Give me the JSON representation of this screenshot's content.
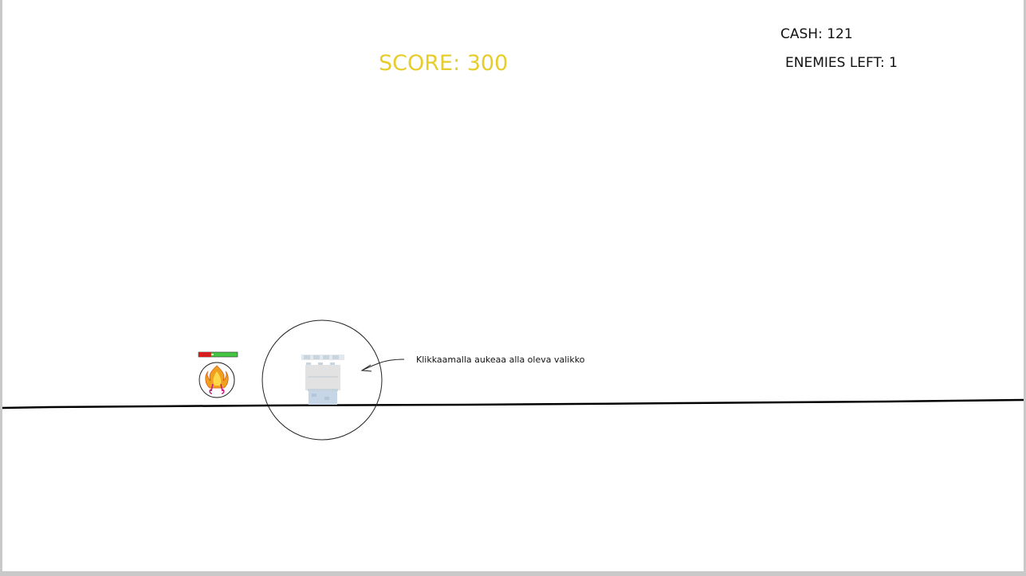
{
  "hud": {
    "cash_label": "CASH: 121",
    "enemies_label": "ENEMIES LEFT: 1",
    "score_label": "SCORE: 300"
  },
  "scene": {
    "hint_text": "Klikkaamalla aukeaa alla oleva valikko",
    "enemy": {
      "icon": "fire-creature-icon",
      "health_fraction": 0.32
    },
    "tower": {
      "icon": "castle-tower-icon"
    }
  },
  "colors": {
    "score": "#e8cc2a",
    "health_good": "#43c443",
    "health_bad": "#d71d1d",
    "ground": "#000000"
  }
}
